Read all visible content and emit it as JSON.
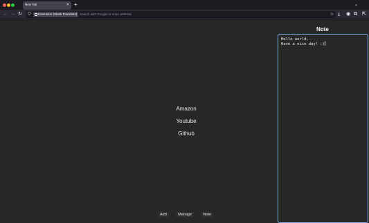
{
  "browser": {
    "tab": {
      "title": "New Tab",
      "close_icon": "close-icon"
    },
    "new_tab_icon": "plus-icon",
    "tab_list_icon": "chevron-down-icon",
    "nav": {
      "back_icon": "arrow-left-icon",
      "forward_icon": "arrow-right-icon",
      "reload_icon": "reload-icon"
    },
    "urlbar": {
      "identity_label": "Extension (Sleek Favorites)",
      "placeholder": "Search with Google or enter address",
      "bookmark_icon": "star-icon"
    },
    "toolbar_icons": [
      "download-icon",
      "account-icon",
      "extensions-icon",
      "share-icon"
    ]
  },
  "links": [
    {
      "label": "Amazon"
    },
    {
      "label": "Youtube"
    },
    {
      "label": "Github"
    }
  ],
  "note": {
    "title": "Note",
    "text": "Hello world,\nHave a nice day! :)"
  },
  "bottom_buttons": [
    {
      "label": "Add"
    },
    {
      "label": "Manage"
    },
    {
      "label": "Note"
    }
  ]
}
